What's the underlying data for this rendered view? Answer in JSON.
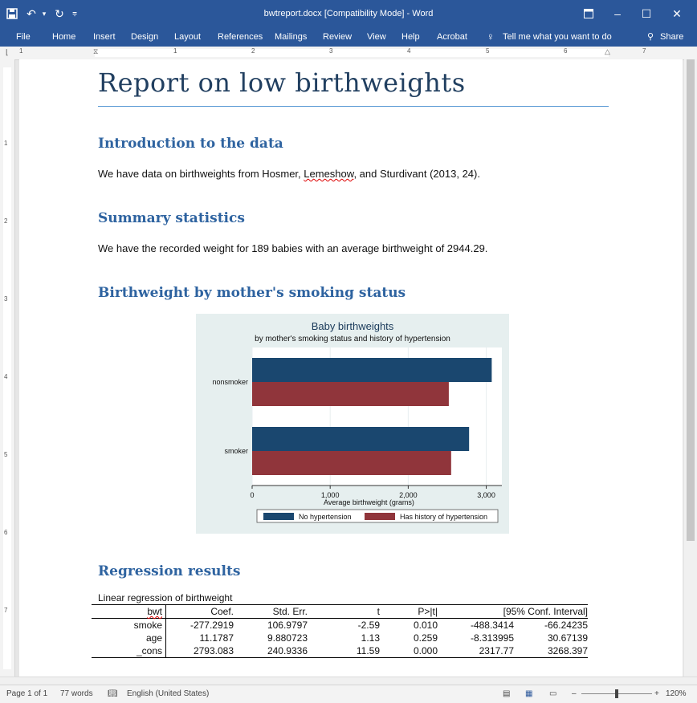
{
  "window": {
    "title": "bwtreport.docx [Compatibility Mode]  -  Word"
  },
  "ribbon": {
    "tabs": [
      "File",
      "Home",
      "Insert",
      "Design",
      "Layout",
      "References",
      "Mailings",
      "Review",
      "View",
      "Help",
      "Acrobat"
    ],
    "tell_me": "Tell me what you want to do",
    "share": "Share"
  },
  "ruler": {
    "numbers": [
      "1",
      "1",
      "2",
      "3",
      "4",
      "5",
      "6",
      "7"
    ],
    "vnumbers": [
      "1",
      "2",
      "3",
      "4",
      "5",
      "6",
      "7"
    ]
  },
  "document": {
    "title": "Report on low birthweights",
    "sections": [
      {
        "heading": "Introduction to the data",
        "text_before": "We have data on birthweights from Hosmer, ",
        "text_squiggle": "Lemeshow",
        "text_after": ", and Sturdivant (2013, 24)."
      },
      {
        "heading": "Summary statistics",
        "text": "We have the recorded weight for 189 babies with an average birthweight of 2944.29."
      },
      {
        "heading": "Birthweight by mother's smoking status"
      },
      {
        "heading": "Regression results"
      }
    ],
    "regression": {
      "caption": "Linear regression of birthweight",
      "header": [
        "bwt",
        "Coef.",
        "Std. Err.",
        "t",
        "P>|t|",
        "[95% Conf. Interval]"
      ],
      "rows": [
        [
          "smoke",
          "-277.2919",
          "106.9797",
          "-2.59",
          "0.010",
          "-488.3414",
          "-66.24235"
        ],
        [
          "age",
          "11.1787",
          "9.880723",
          "1.13",
          "0.259",
          "-8.313995",
          "30.67139"
        ],
        [
          "_cons",
          "2793.083",
          "240.9336",
          "11.59",
          "0.000",
          "2317.77",
          "3268.397"
        ]
      ]
    }
  },
  "chart_data": {
    "type": "bar",
    "orientation": "horizontal",
    "title": "Baby birthweights",
    "subtitle": "by mother's smoking status and history of hypertension",
    "categories": [
      "nonsmoker",
      "smoker"
    ],
    "series": [
      {
        "name": "No hypertension",
        "color": "#1a476f",
        "values": [
          3070,
          2780
        ]
      },
      {
        "name": "Has history of hypertension",
        "color": "#90353b",
        "values": [
          2520,
          2550
        ]
      }
    ],
    "xlabel": "Average birthweight (grams)",
    "ylabel": "",
    "xlim": [
      0,
      3200
    ],
    "xticks": [
      0,
      1000,
      2000,
      3000
    ],
    "xtick_labels": [
      "0",
      "1,000",
      "2,000",
      "3,000"
    ],
    "grid": true,
    "legend_position": "bottom"
  },
  "status": {
    "page": "Page 1 of 1",
    "words": "77 words",
    "language": "English (United States)",
    "zoom": "120%"
  },
  "colors": {
    "accent": "#2b579a",
    "heading": "#2e63a0",
    "title": "#213f60"
  }
}
